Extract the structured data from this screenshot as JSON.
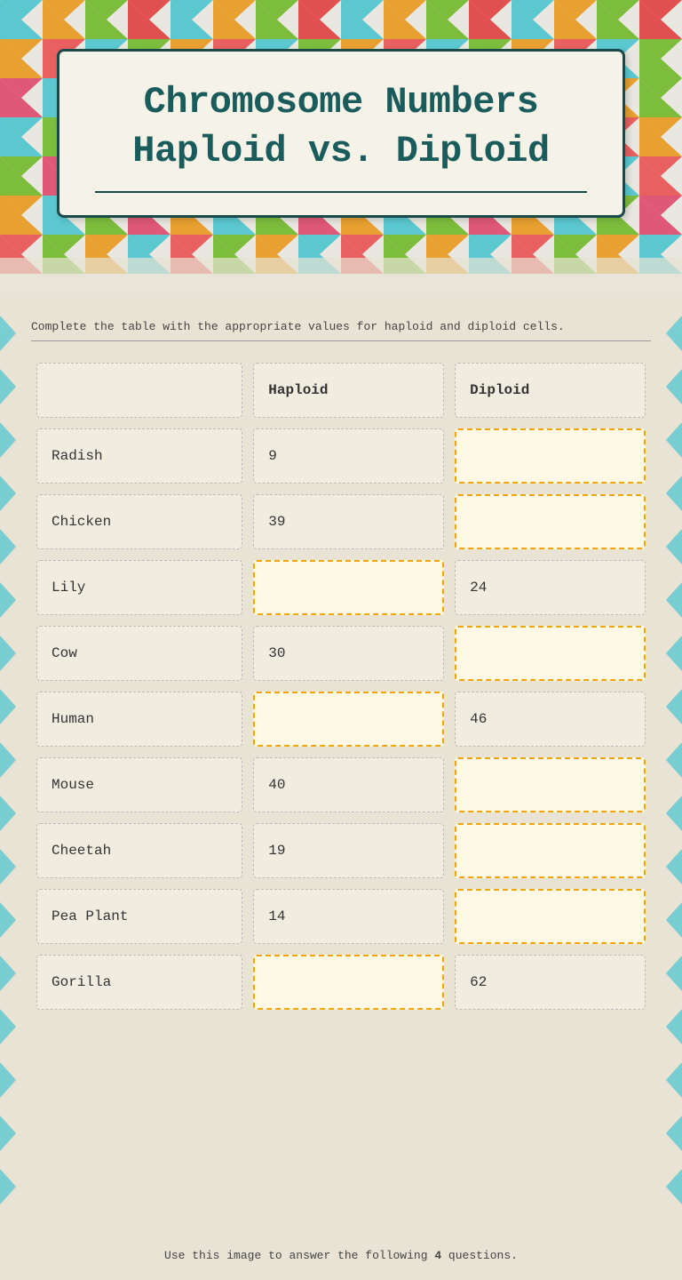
{
  "page": {
    "title_line1": "Chromosome Numbers",
    "title_line2": "Haploid vs. Diploid",
    "instruction": "Complete the table with the appropriate values for haploid and diploid cells.",
    "bottom_text": "Use this image to answer the following 4 questions.",
    "columns": {
      "organism": "",
      "haploid": "Haploid",
      "diploid": "Diploid"
    },
    "rows": [
      {
        "organism": "Radish",
        "haploid": "9",
        "diploid": "",
        "haploid_blank": false,
        "diploid_blank": true
      },
      {
        "organism": "Chicken",
        "haploid": "39",
        "diploid": "",
        "haploid_blank": false,
        "diploid_blank": true
      },
      {
        "organism": "Lily",
        "haploid": "",
        "diploid": "24",
        "haploid_blank": true,
        "diploid_blank": false
      },
      {
        "organism": "Cow",
        "haploid": "30",
        "diploid": "",
        "haploid_blank": false,
        "diploid_blank": true
      },
      {
        "organism": "Human",
        "haploid": "",
        "diploid": "46",
        "haploid_blank": true,
        "diploid_blank": false
      },
      {
        "organism": "Mouse",
        "haploid": "40",
        "diploid": "",
        "haploid_blank": false,
        "diploid_blank": true
      },
      {
        "organism": "Cheetah",
        "haploid": "19",
        "diploid": "",
        "haploid_blank": false,
        "diploid_blank": true
      },
      {
        "organism": "Pea Plant",
        "haploid": "14",
        "diploid": "",
        "haploid_blank": false,
        "diploid_blank": true
      },
      {
        "organism": "Gorilla",
        "haploid": "",
        "diploid": "62",
        "haploid_blank": true,
        "diploid_blank": false
      }
    ]
  },
  "colors": {
    "accent": "#1a5c5c",
    "border": "#1a4a4a",
    "blank_bg": "#fef9e7",
    "blank_border": "#f0a500"
  }
}
